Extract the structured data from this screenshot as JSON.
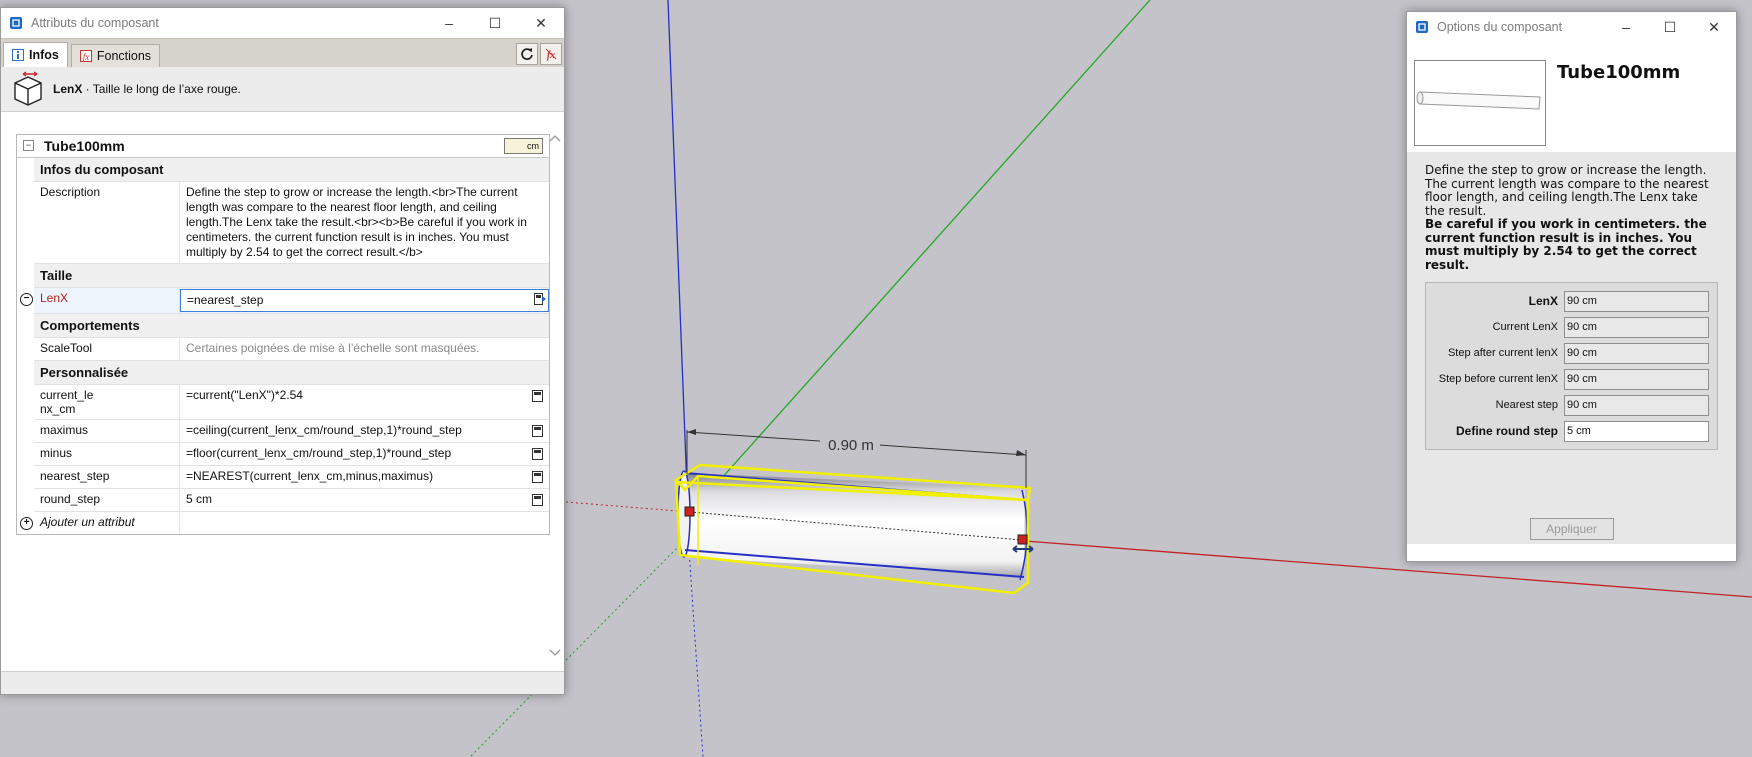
{
  "attributes_window": {
    "title": "Attributs du composant",
    "tabs": [
      {
        "label": "Infos",
        "active": true
      },
      {
        "label": "Fonctions",
        "active": false
      }
    ],
    "header_attr": "LenX",
    "header_sep": " · ",
    "header_desc": "Taille le long de l’axe rouge.",
    "component_name": "Tube100mm",
    "unit": "cm",
    "sections": {
      "info": "Infos du composant",
      "size": "Taille",
      "behaviors": "Comportements",
      "custom": "Personnalisée"
    },
    "description_label": "Description",
    "description_value": "Define the step to grow or increase the length.<br>The current length was compare to the nearest floor length, and ceiling length.The Lenx take the result.<br><b>Be careful if you work in centimeters. the current function result is in inches. You must multiply by 2.54 to get the correct result.</b>",
    "lenx_label": "LenX",
    "lenx_value": "=nearest_step",
    "scaletool_label": "ScaleTool",
    "scaletool_value": "Certaines poignées de mise à l’échelle sont masquées.",
    "custom_rows": [
      {
        "name": "current_le\nnx_cm",
        "value": "=current(\"LenX\")*2.54"
      },
      {
        "name": "maximus",
        "value": "=ceiling(current_lenx_cm/round_step,1)*round_step"
      },
      {
        "name": "minus",
        "value": "=floor(current_lenx_cm/round_step,1)*round_step"
      },
      {
        "name": "nearest_step",
        "value": "=NEAREST(current_lenx_cm,minus,maximus)"
      },
      {
        "name": "round_step",
        "value": "5 cm"
      }
    ],
    "add_attribute": "Ajouter un attribut"
  },
  "viewport": {
    "dimension_label": "0.90 m"
  },
  "options_window": {
    "title": "Options du composant",
    "component_name": "Tube100mm",
    "description": "Define the step to grow or increase the length. The current length was compare to the nearest floor length, and ceiling length.The Lenx take the result.",
    "description_bold": "Be careful if you work in centimeters. the current function result is in inches. You must multiply by 2.54 to get the correct result.",
    "fields": [
      {
        "label": "LenX",
        "value": "90 cm",
        "bold": true,
        "editable": false
      },
      {
        "label": "Current LenX",
        "value": "90 cm",
        "bold": false,
        "editable": false
      },
      {
        "label": "Step after current lenX",
        "value": "90 cm",
        "bold": false,
        "editable": false
      },
      {
        "label": "Step before current lenX",
        "value": "90 cm",
        "bold": false,
        "editable": false
      },
      {
        "label": "Nearest step",
        "value": "90 cm",
        "bold": false,
        "editable": false
      },
      {
        "label": "Define round step",
        "value": "5 cm",
        "bold": true,
        "editable": true
      }
    ],
    "apply_label": "Appliquer"
  },
  "colors": {
    "viewport_bg": "#c4c3c9",
    "selection": "#ffff00",
    "red_axis": "#cc2222",
    "green_axis": "#22aa22",
    "blue_axis": "#2222cc",
    "edited_attr": "#b22222"
  }
}
